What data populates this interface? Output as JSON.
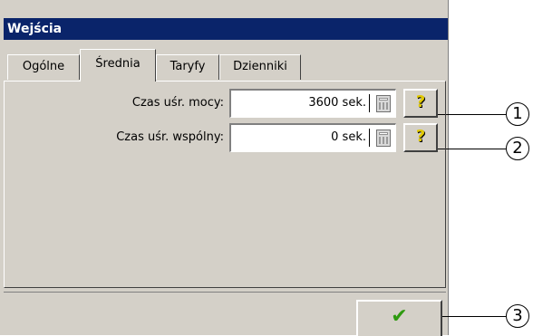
{
  "window": {
    "title": "Wejścia"
  },
  "tabs": [
    {
      "label": "Ogólne",
      "active": false
    },
    {
      "label": "Średnia",
      "active": true
    },
    {
      "label": "Taryfy",
      "active": false
    },
    {
      "label": "Dzienniki",
      "active": false
    }
  ],
  "fields": [
    {
      "label": "Czas uśr. mocy:",
      "value": "3600 sek."
    },
    {
      "label": "Czas uśr. wspólny:",
      "value": "0 sek."
    }
  ],
  "buttons": {
    "help_glyph": "?",
    "ok_glyph": "✔"
  },
  "callouts": [
    "1",
    "2",
    "3"
  ],
  "icons": {
    "calculator": "calculator-icon",
    "help": "help-question-icon",
    "ok": "checkmark-icon"
  },
  "colors": {
    "titlebar": "#0a246a",
    "dialog": "#d4d0c8",
    "ok_check": "#2e9a10",
    "help_mark": "#e0c800"
  }
}
